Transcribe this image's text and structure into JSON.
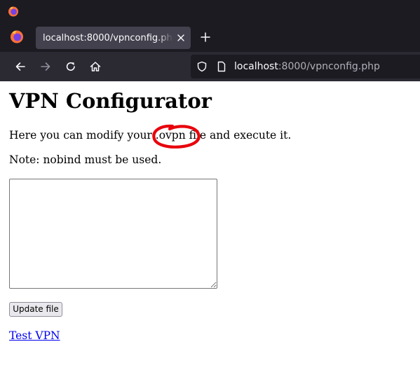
{
  "browser": {
    "tab": {
      "title": "localhost:8000/vpnconfig.php"
    },
    "address_bar": {
      "host": "localhost",
      "rest": ":8000/vpnconfig.php"
    }
  },
  "page": {
    "heading": "VPN Configurator",
    "intro": {
      "before": "Here you can modify your ",
      "highlight": ".ovpn",
      "after": " file and execute it."
    },
    "note": "Note: nobind must be used.",
    "config_textarea": {
      "value": ""
    },
    "update_button": "Update file",
    "test_link": "Test VPN"
  },
  "annotation": {
    "type": "hand-drawn circle",
    "color": "#e8000b",
    "target": ".ovpn"
  },
  "colors": {
    "titlebar": "#1c1b22",
    "tab_active": "#42414d",
    "toolbar": "#2b2a33",
    "url_field": "#1c1b22",
    "link": "#0000ee",
    "annotation_red": "#e8000b"
  },
  "icons": [
    "firefox-logo-icon",
    "close-icon",
    "plus-icon",
    "back-arrow-icon",
    "forward-arrow-icon",
    "reload-icon",
    "home-icon",
    "shield-icon",
    "page-icon"
  ]
}
